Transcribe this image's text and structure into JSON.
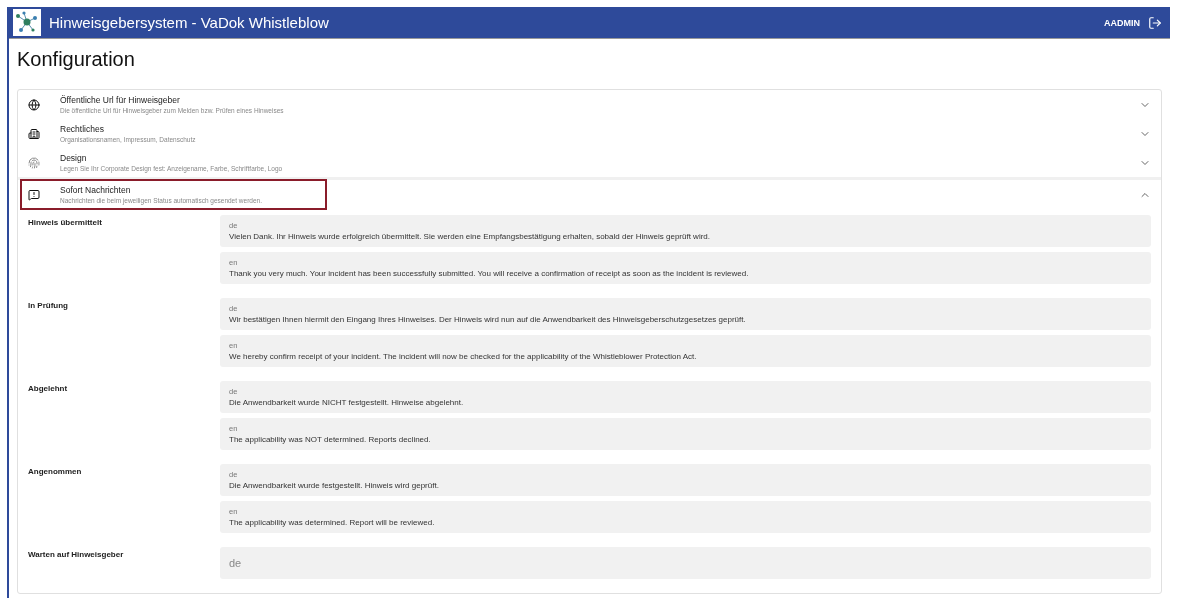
{
  "header": {
    "title": "Hinweisgebersystem - VaDok Whistleblow",
    "user": "AADMIN"
  },
  "page_title": "Konfiguration",
  "panels": [
    {
      "title": "Öffentliche Url für Hinweisgeber",
      "subtitle": "Die öffentliche Url für Hinweisgeber zum Melden bzw. Prüfen eines Hinweises",
      "expanded": false,
      "highlighted": false
    },
    {
      "title": "Rechtliches",
      "subtitle": "Organisationsnamen, Impressum, Datenschutz",
      "expanded": false,
      "highlighted": false
    },
    {
      "title": "Design",
      "subtitle": "Legen Sie Ihr Corporate Design fest: Anzeigename, Farbe, Schriftfarbe, Logo",
      "expanded": false,
      "highlighted": false
    },
    {
      "title": "Sofort Nachrichten",
      "subtitle": "Nachrichten die beim jeweiligen Status automatisch gesendet werden.",
      "expanded": true,
      "highlighted": true
    }
  ],
  "messages": [
    {
      "status": "Hinweis übermittelt",
      "fields": [
        {
          "label": "de",
          "value": "Vielen Dank. Ihr Hinweis wurde erfolgreich übermittelt. Sie werden eine Empfangsbestätigung erhalten, sobald der Hinweis geprüft wird."
        },
        {
          "label": "en",
          "value": "Thank you very much. Your incident has been successfully submitted. You will receive a confirmation of receipt as soon as the incident is reviewed."
        }
      ]
    },
    {
      "status": "In Prüfung",
      "fields": [
        {
          "label": "de",
          "value": "Wir bestätigen Ihnen hiermit den Eingang Ihres Hinweises. Der Hinweis wird nun auf die Anwendbarkeit des Hinweisgeberschutzgesetzes geprüft."
        },
        {
          "label": "en",
          "value": "We hereby confirm receipt of your incident. The incident will now be checked for the applicability of the Whistleblower Protection Act."
        }
      ]
    },
    {
      "status": "Abgelehnt",
      "fields": [
        {
          "label": "de",
          "value": "Die Anwendbarkeit wurde NICHT festgestellt. Hinweise abgelehnt."
        },
        {
          "label": "en",
          "value": "The applicability was NOT determined. Reports declined."
        }
      ]
    },
    {
      "status": "Angenommen",
      "fields": [
        {
          "label": "de",
          "value": "Die Anwendbarkeit wurde festgestellt. Hinweis wird geprüft."
        },
        {
          "label": "en",
          "value": "The applicability was determined. Report will be reviewed."
        }
      ]
    },
    {
      "status": "Warten auf Hinweisgeber",
      "fields": [
        {
          "placeholder": "de"
        }
      ]
    }
  ]
}
